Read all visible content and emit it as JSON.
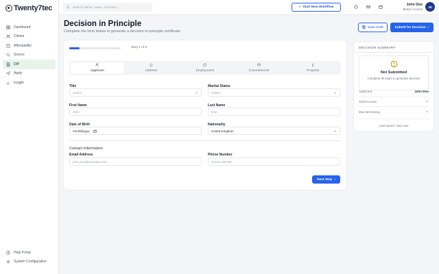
{
  "brand": {
    "name": "Twenty7tec"
  },
  "sidebar": {
    "items": [
      {
        "label": "Dashboard",
        "icon": "grid-icon"
      },
      {
        "label": "Clients",
        "icon": "users-icon"
      },
      {
        "label": "Affordability",
        "icon": "calculator-icon"
      },
      {
        "label": "Source",
        "icon": "search-icon"
      },
      {
        "label": "DIP",
        "icon": "file-icon",
        "active": true
      },
      {
        "label": "Apply",
        "icon": "send-icon"
      },
      {
        "label": "Insight",
        "icon": "chart-icon"
      }
    ],
    "bottom": [
      {
        "label": "Help Portal",
        "icon": "help-icon"
      },
      {
        "label": "System Configuration",
        "icon": "gear-icon"
      }
    ]
  },
  "topbar": {
    "search_placeholder": "Search clients, cases, or lenders...",
    "workflow_label": "Start New Workflow",
    "user_name": "John Doe",
    "user_role": "Broker Account",
    "avatar_initials": "JD"
  },
  "header": {
    "title": "Decision in Principle",
    "subtitle": "Complete the form below to generate a decision in principle certificate.",
    "save_draft": "Save Draft",
    "submit": "Submit for Decision"
  },
  "form": {
    "progress": 0.2,
    "step_label": "Step 1 of 5",
    "tabs": [
      {
        "label": "Applicant",
        "icon": "user-icon",
        "active": true
      },
      {
        "label": "Address",
        "icon": "home-icon"
      },
      {
        "label": "Employment",
        "icon": "briefcase-icon"
      },
      {
        "label": "Commitments",
        "icon": "card-icon"
      },
      {
        "label": "Property",
        "icon": "pound-icon"
      }
    ],
    "title_label": "Title",
    "title_value": "Select",
    "marital_label": "Marital Status",
    "marital_value": "Select",
    "first_name_label": "First Name",
    "first_name_placeholder": "John",
    "last_name_label": "Last Name",
    "last_name_placeholder": "Doe",
    "dob_label": "Date of Birth",
    "dob_value": "mm/dd/yyyy",
    "nationality_label": "Nationality",
    "nationality_value": "United Kingdom",
    "contact_title": "Contact Information",
    "email_label": "Email Address",
    "email_placeholder": "john.doe@example.com",
    "phone_label": "Phone Number",
    "phone_placeholder": "07123 456789",
    "next_label": "Next Step"
  },
  "summary": {
    "title": "DECISION SUMMARY",
    "status": "Not Submitted",
    "status_sub": "Complete all steps to generate decision",
    "applicant_label": "Applicant",
    "applicant_value": "John Doe",
    "income_label": "Total Income",
    "borrowing_label": "Max Borrowing",
    "last_saved": "Last saved: Just now"
  },
  "colors": {
    "accent": "#2563eb",
    "active_nav": "#e8f3ea",
    "warning": "#ca8a04"
  }
}
